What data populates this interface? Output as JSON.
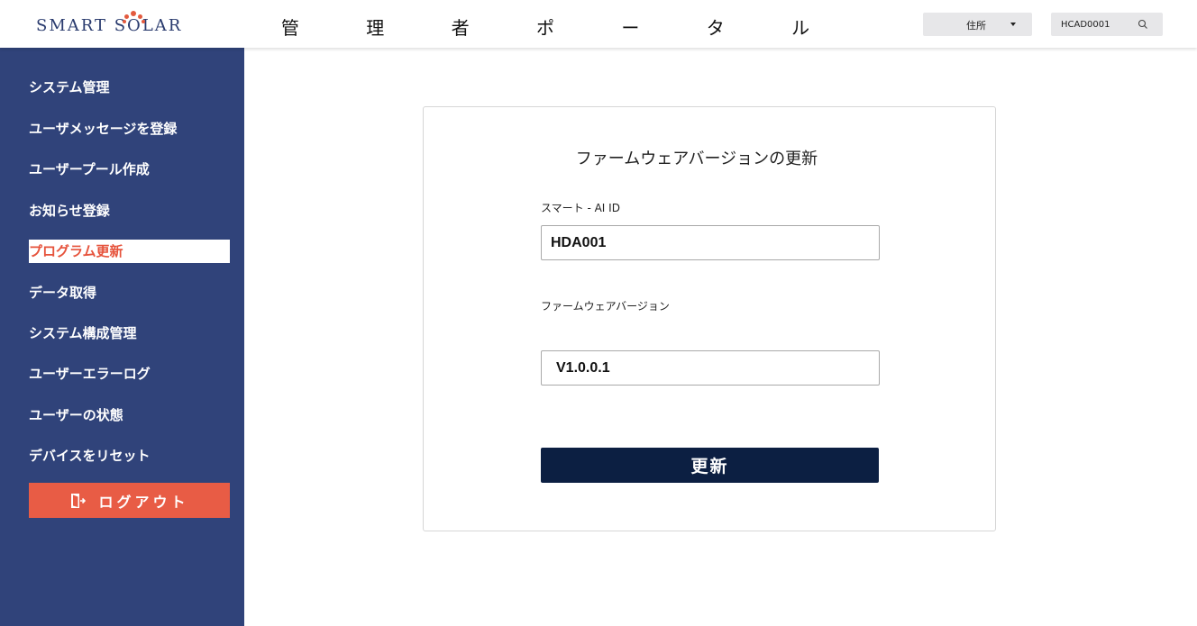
{
  "header": {
    "logo_text": "SMART SOLAR",
    "title": "管 理 者 ポ ー タ ル",
    "address_select_label": "住所",
    "search_value": "HCAD0001"
  },
  "sidebar": {
    "items": [
      {
        "label": "システム管理",
        "active": false
      },
      {
        "label": "ユーザメッセージを登録",
        "active": false
      },
      {
        "label": "ユーザープール作成",
        "active": false
      },
      {
        "label": "お知らせ登録",
        "active": false
      },
      {
        "label": "プログラム更新",
        "active": true
      },
      {
        "label": "データ取得",
        "active": false
      },
      {
        "label": "システム構成管理",
        "active": false
      },
      {
        "label": "ユーザーエラーログ",
        "active": false
      },
      {
        "label": "ユーザーの状態",
        "active": false
      },
      {
        "label": "デバイスをリセット",
        "active": false
      }
    ],
    "logout_label": "ログアウト"
  },
  "form": {
    "title": "ファームウェアバージョンの更新",
    "device_id_label": "スマート - AI ID",
    "device_id_value": "HDA001",
    "firmware_label": "ファームウェアバージョン",
    "firmware_value": "V1.0.0.1",
    "submit_label": "更新"
  },
  "colors": {
    "sidebar_bg": "#30437a",
    "active_text": "#e6533c",
    "logout_bg": "#e85c45",
    "submit_bg": "#0c1f42",
    "logo_accent": "#e35a3e"
  },
  "icons": {
    "search": "magnifier-icon",
    "logout": "door-exit-icon",
    "dropdown": "caret-down-icon"
  }
}
